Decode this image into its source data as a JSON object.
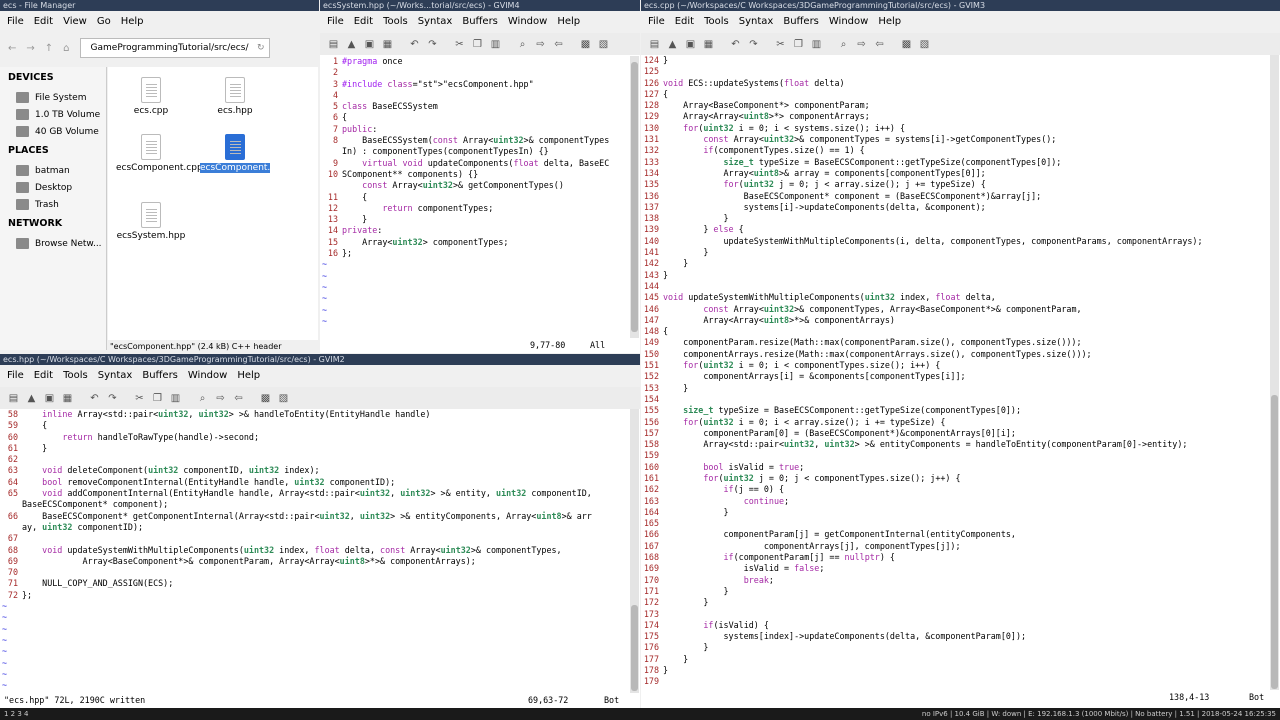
{
  "fm": {
    "title": "ecs - File Manager",
    "menu": [
      "File",
      "Edit",
      "View",
      "Go",
      "Help"
    ],
    "path": "GameProgrammingTutorial/src/ecs/",
    "sections": [
      {
        "h": "DEVICES",
        "items": [
          "File System",
          "1.0 TB Volume",
          "40 GB Volume"
        ]
      },
      {
        "h": "PLACES",
        "items": [
          "batman",
          "Desktop",
          "Trash"
        ]
      },
      {
        "h": "NETWORK",
        "items": [
          "Browse Netw..."
        ]
      }
    ],
    "files": [
      "ecs.cpp",
      "ecs.hpp",
      "ecsComponent.cpp",
      "ecsComponent.hpp",
      "ecsSystem.hpp"
    ],
    "status": "\"ecsComponent.hpp\" (2.4 kB) C++ header"
  },
  "sys": {
    "title": "ecsSystem.hpp (~/Works...torial/src/ecs) - GVIM4",
    "menu": [
      "File",
      "Edit",
      "Tools",
      "Syntax",
      "Buffers",
      "Window",
      "Help"
    ],
    "pos": "9,77-80",
    "scroll": "All"
  },
  "hpp": {
    "title": "ecs.hpp (~/Workspaces/C Workspaces/3DGameProgrammingTutorial/src/ecs) - GVIM2",
    "menu": [
      "File",
      "Edit",
      "Tools",
      "Syntax",
      "Buffers",
      "Window",
      "Help"
    ],
    "msg": "\"ecs.hpp\" 72L, 2190C written",
    "pos": "69,63-72",
    "scroll": "Bot"
  },
  "cpp": {
    "title": "ecs.cpp (~/Workspaces/C Workspaces/3DGameProgrammingTutorial/src/ecs) - GVIM3",
    "menu": [
      "File",
      "Edit",
      "Tools",
      "Syntax",
      "Buffers",
      "Window",
      "Help"
    ],
    "pos": "138,4-13",
    "scroll": "Bot"
  },
  "taskbar": {
    "left": "1  2  3  4",
    "right": "no IPv6 | 10.4 GiB | W: down | E: 192.168.1.3 (1000 Mbit/s) | No battery | 1.51 | 2018-05-24 16:25:35"
  }
}
